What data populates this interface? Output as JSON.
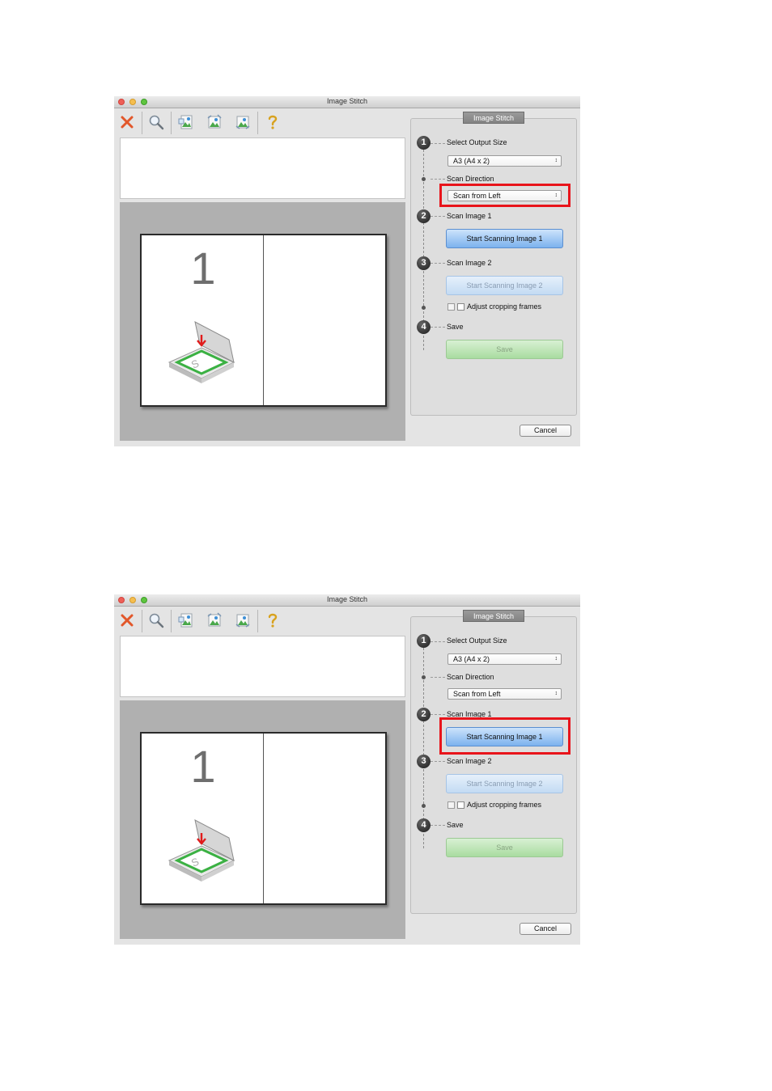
{
  "windows": [
    {
      "title": "Image Stitch",
      "toolbar_icons": [
        "close-x-icon",
        "zoom-icon",
        "image-icon",
        "image-icon",
        "image-icon",
        "help-icon"
      ],
      "preview": {
        "page_number": "1"
      },
      "panel": {
        "title": "Image Stitch",
        "step1": {
          "number": "1",
          "label": "Select Output Size",
          "output_size_value": "A3 (A4 x 2)"
        },
        "scan_direction": {
          "label": "Scan Direction",
          "value": "Scan from Left"
        },
        "step2": {
          "number": "2",
          "label": "Scan Image 1",
          "button": "Start Scanning Image 1"
        },
        "step3": {
          "number": "3",
          "label": "Scan Image 2",
          "button": "Start Scanning Image 2"
        },
        "adjust_cropping": {
          "label": "Adjust cropping frames",
          "checked": false
        },
        "step4": {
          "number": "4",
          "label": "Save",
          "button": "Save"
        }
      },
      "cancel_label": "Cancel",
      "highlight": "scan-direction-select",
      "highlight_color": "#e8141b"
    },
    {
      "title": "Image Stitch",
      "toolbar_icons": [
        "close-x-icon",
        "zoom-icon",
        "image-icon",
        "image-icon",
        "image-icon",
        "help-icon"
      ],
      "preview": {
        "page_number": "1"
      },
      "panel": {
        "title": "Image Stitch",
        "step1": {
          "number": "1",
          "label": "Select Output Size",
          "output_size_value": "A3 (A4 x 2)"
        },
        "scan_direction": {
          "label": "Scan Direction",
          "value": "Scan from Left"
        },
        "step2": {
          "number": "2",
          "label": "Scan Image 1",
          "button": "Start Scanning Image 1"
        },
        "step3": {
          "number": "3",
          "label": "Scan Image 2",
          "button": "Start Scanning Image 2"
        },
        "adjust_cropping": {
          "label": "Adjust cropping frames",
          "checked": false
        },
        "step4": {
          "number": "4",
          "label": "Save",
          "button": "Save"
        }
      },
      "cancel_label": "Cancel",
      "highlight": "start-scanning-image-1-button",
      "highlight_color": "#e8141b"
    }
  ]
}
